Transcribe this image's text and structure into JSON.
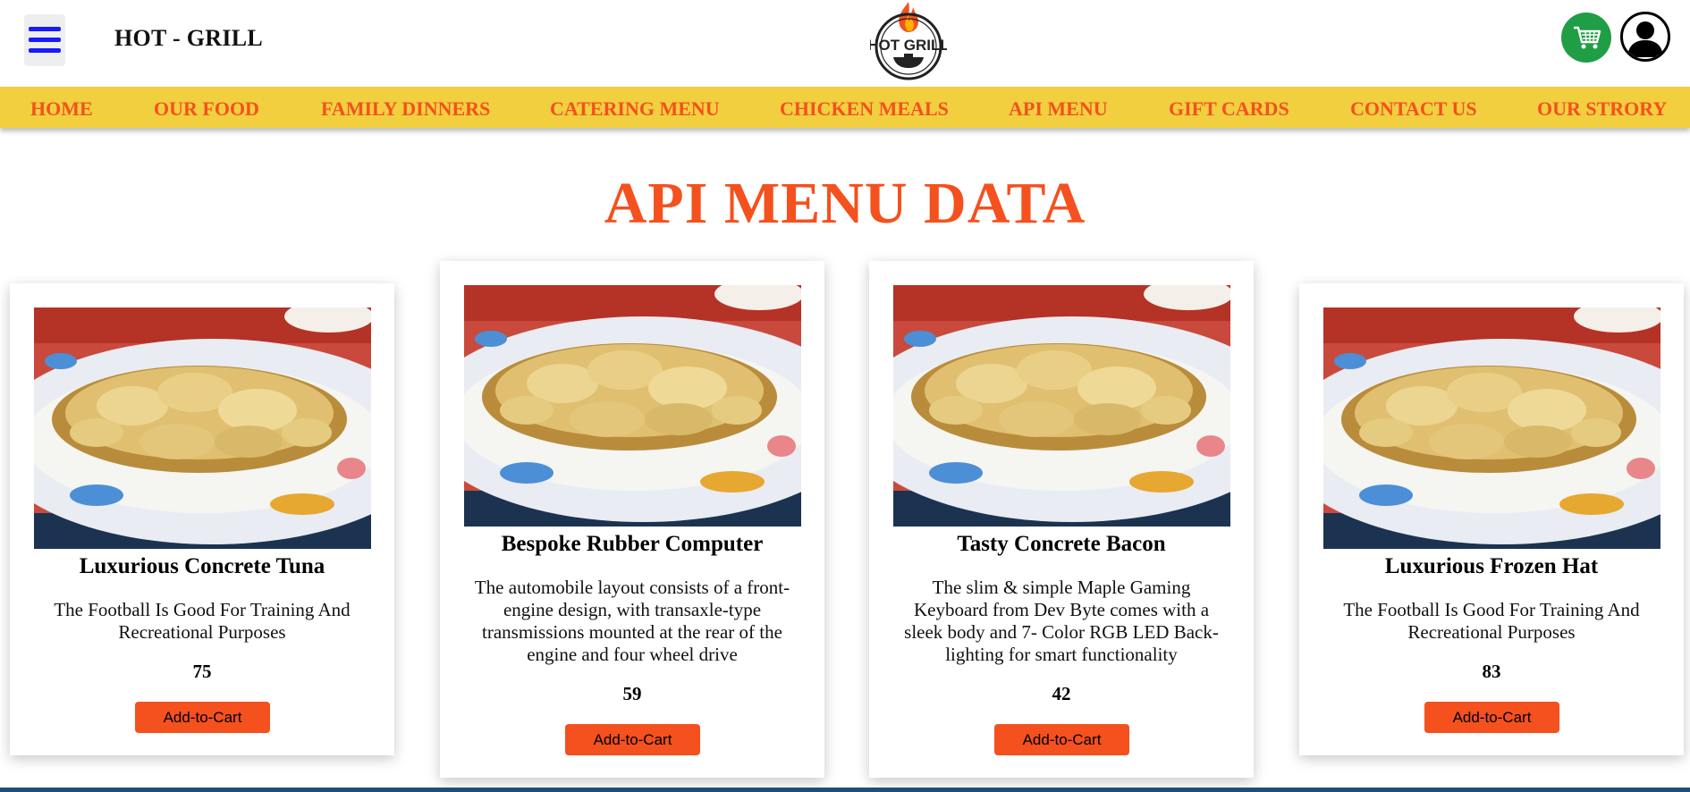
{
  "header": {
    "brand": "HOT - GRILL",
    "logo_text": "HOT GRILL",
    "menu_icon": "hamburger-icon",
    "cart_icon": "cart-icon",
    "user_icon": "user-icon"
  },
  "nav": {
    "items": [
      {
        "label": "HOME"
      },
      {
        "label": "OUR FOOD"
      },
      {
        "label": "FAMILY DINNERS"
      },
      {
        "label": "CATERING MENU"
      },
      {
        "label": "CHICKEN MEALS"
      },
      {
        "label": "API MENU"
      },
      {
        "label": "GIFT CARDS"
      },
      {
        "label": "CONTACT US"
      },
      {
        "label": "OUR STRORY"
      }
    ]
  },
  "page": {
    "title": "API MENU DATA"
  },
  "cards": [
    {
      "name": "Luxurious Concrete Tuna",
      "desc_lines": [
        "The Football Is Good For Training And",
        "Recreational Purposes"
      ],
      "price": "75",
      "button": "Add-to-Cart"
    },
    {
      "name": "Bespoke Rubber Computer",
      "desc_lines": [
        "The automobile layout consists of a front-",
        "engine design, with transaxle-type",
        "transmissions mounted at the rear of the",
        "engine and four wheel drive"
      ],
      "price": "59",
      "button": "Add-to-Cart"
    },
    {
      "name": "Tasty Concrete Bacon",
      "desc_lines": [
        "The slim & simple Maple Gaming",
        "Keyboard from Dev Byte comes with a",
        "sleek body and 7- Color RGB LED Back-",
        "lighting for smart functionality"
      ],
      "price": "42",
      "button": "Add-to-Cart"
    },
    {
      "name": "Luxurious Frozen Hat",
      "desc_lines": [
        "The Football Is Good For Training And",
        "Recreational Purposes"
      ],
      "price": "83",
      "button": "Add-to-Cart"
    }
  ],
  "colors": {
    "accent": "#f4511e",
    "nav_bg": "#f1cf3f",
    "cart_bg": "#1f9e45",
    "menu_lines": "#1a1aff"
  }
}
